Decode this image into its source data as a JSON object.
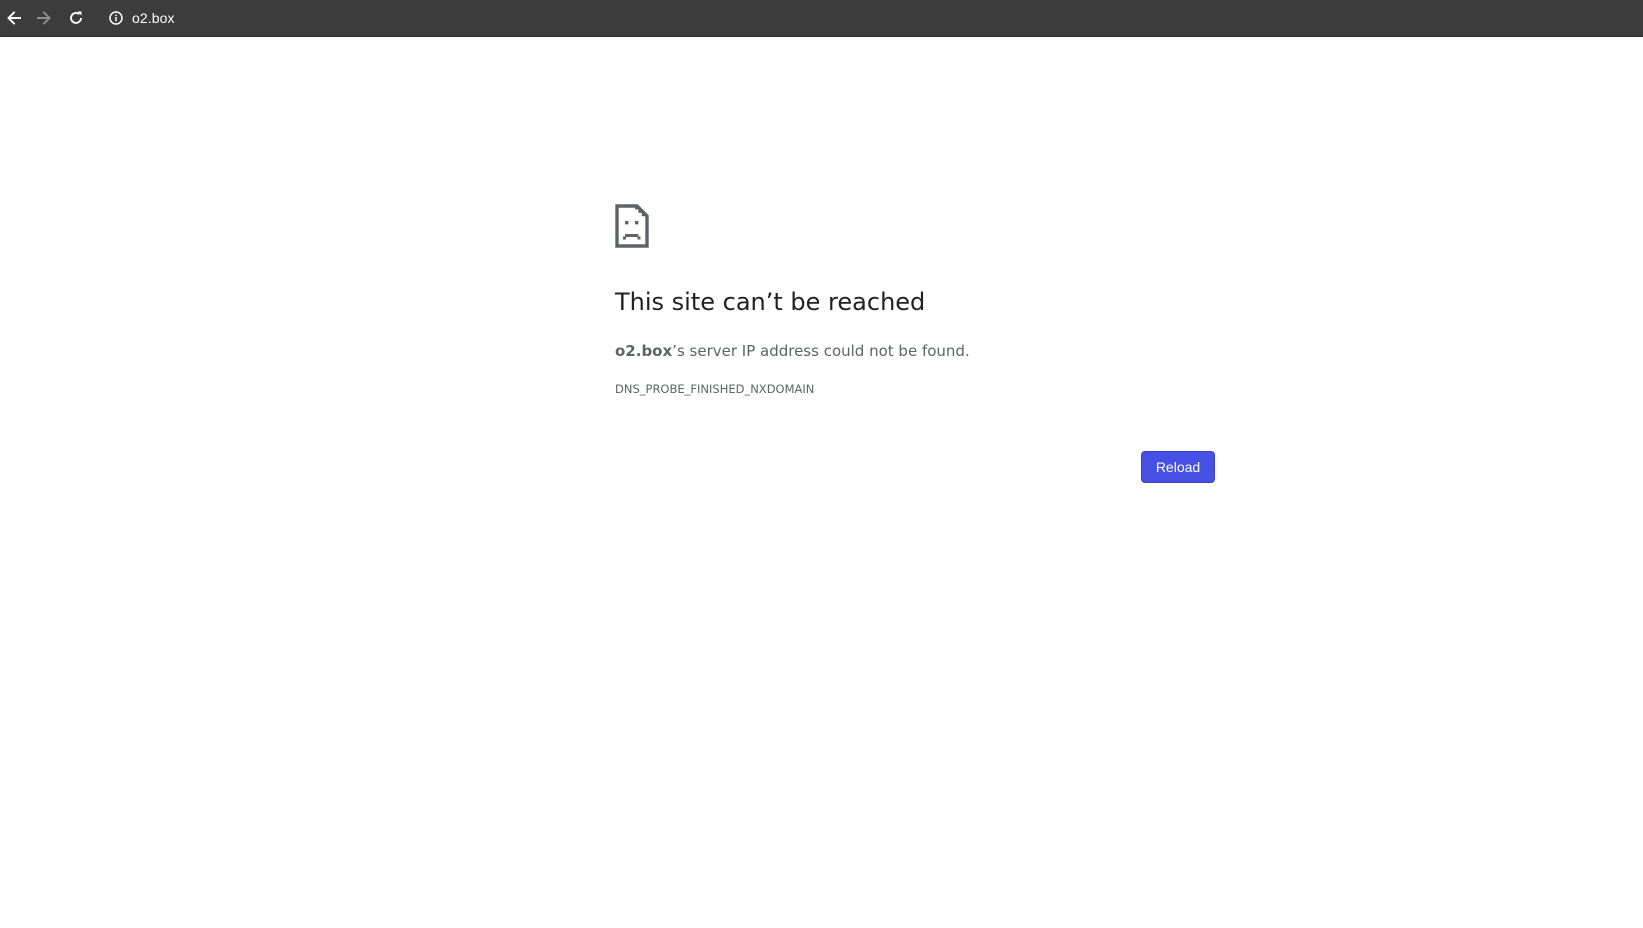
{
  "browser": {
    "url": "o2.box",
    "icons": {
      "back": "arrow-left-icon",
      "forward": "arrow-right-icon",
      "reload": "reload-icon",
      "site_info": "info-circle-icon"
    }
  },
  "error": {
    "icon": "sad-document-icon",
    "title": "This site can’t be reached",
    "host": "o2.box",
    "summary_rest": "’s server IP address could not be found.",
    "code": "DNS_PROBE_FINISHED_NXDOMAIN",
    "reload_label": "Reload"
  },
  "colors": {
    "toolbar_bg": "#3c3c3c",
    "button_bg": "#4650e3",
    "title_text": "#202124",
    "secondary_text": "#5f6368"
  }
}
